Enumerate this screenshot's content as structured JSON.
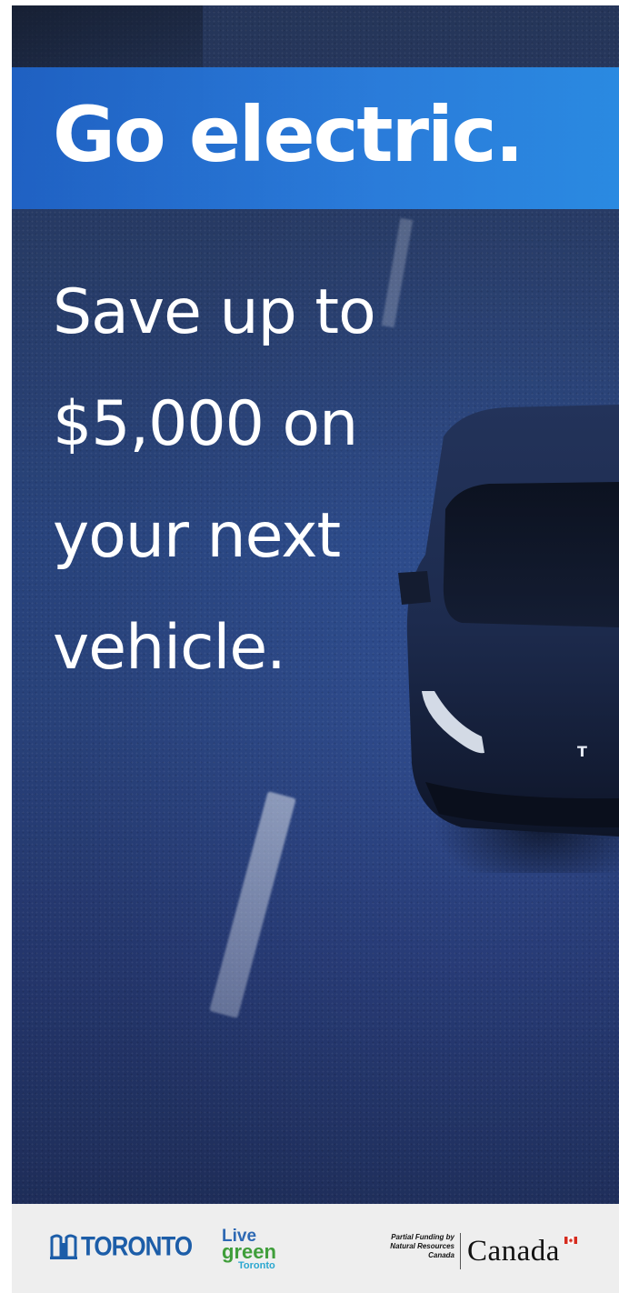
{
  "ad": {
    "headline": "Go electric.",
    "offer_lines": [
      "Save up to",
      "$5,000 on",
      "your next",
      "vehicle."
    ],
    "car_badge": "T"
  },
  "footer": {
    "toronto_logo": "TORONTO",
    "live_green": {
      "line1": "Live",
      "line2": "green",
      "line3": "Toronto"
    },
    "funding_lines": [
      "Partial Funding by",
      "Natural Resources",
      "Canada"
    ],
    "canada_wordmark": "Canada"
  },
  "colors": {
    "banner_blue": "#2a7fe0",
    "photo_blue": "#2f4f92",
    "toronto_blue": "#1c5da8",
    "live_green": "#3f9e3a",
    "footer_bg": "#eeeeee"
  }
}
